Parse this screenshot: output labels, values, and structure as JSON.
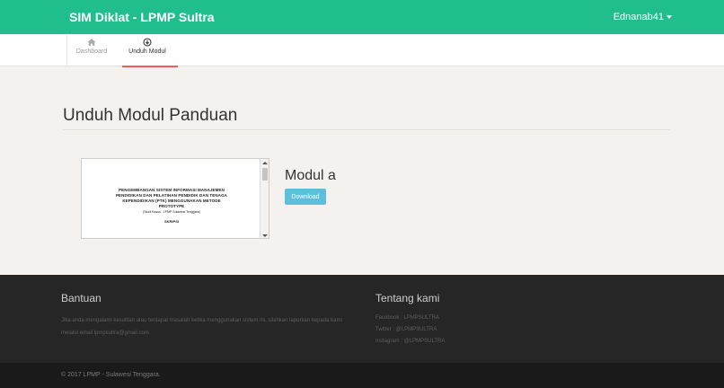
{
  "header": {
    "brand": "SIM Diklat - LPMP Sultra",
    "user": "Ednanab41"
  },
  "nav": {
    "dashboard": "Dashboard",
    "unduh": "Unduh Modul"
  },
  "main": {
    "title": "Unduh Modul Panduan",
    "module": {
      "name": "Modul a",
      "download_label": "Download",
      "doc_lines": [
        "PENGEMBANGAN SISTEM INFORMASI MANAJEMEN",
        "PENDIDIKAN DAN PELATIHAN PENDIDIK DAN TENAGA",
        "KEPENDIDIKAN (PTK) MENGGUNAKAN METODE",
        "PROTOTYPE"
      ],
      "doc_subtitle": "(Studi Kasus : LPMP Sulawesi Tenggara)",
      "doc_section": "SKRIPSI"
    }
  },
  "footer": {
    "bantuan_title": "Bantuan",
    "bantuan_text": "Jika anda mengalami kesulitan atau terdapat masalah ketika menggunakan sistem ini, silahkan laporkan kepada kami melalui email lpmpsultra@gmail.com",
    "tentang_title": "Tentang kami",
    "facebook": "Facebook : LPMPSULTRA",
    "twitter": "Twitter : @LPMPSULTRA",
    "instagram": "Instagram : @LPMPSULTRA",
    "copyright": "© 2017 LPMP - Sulawesi Tenggara."
  },
  "colors": {
    "header": "#1fbe8c",
    "download": "#5bc0de",
    "active_tab": "#e8625a",
    "footer": "#262626"
  }
}
